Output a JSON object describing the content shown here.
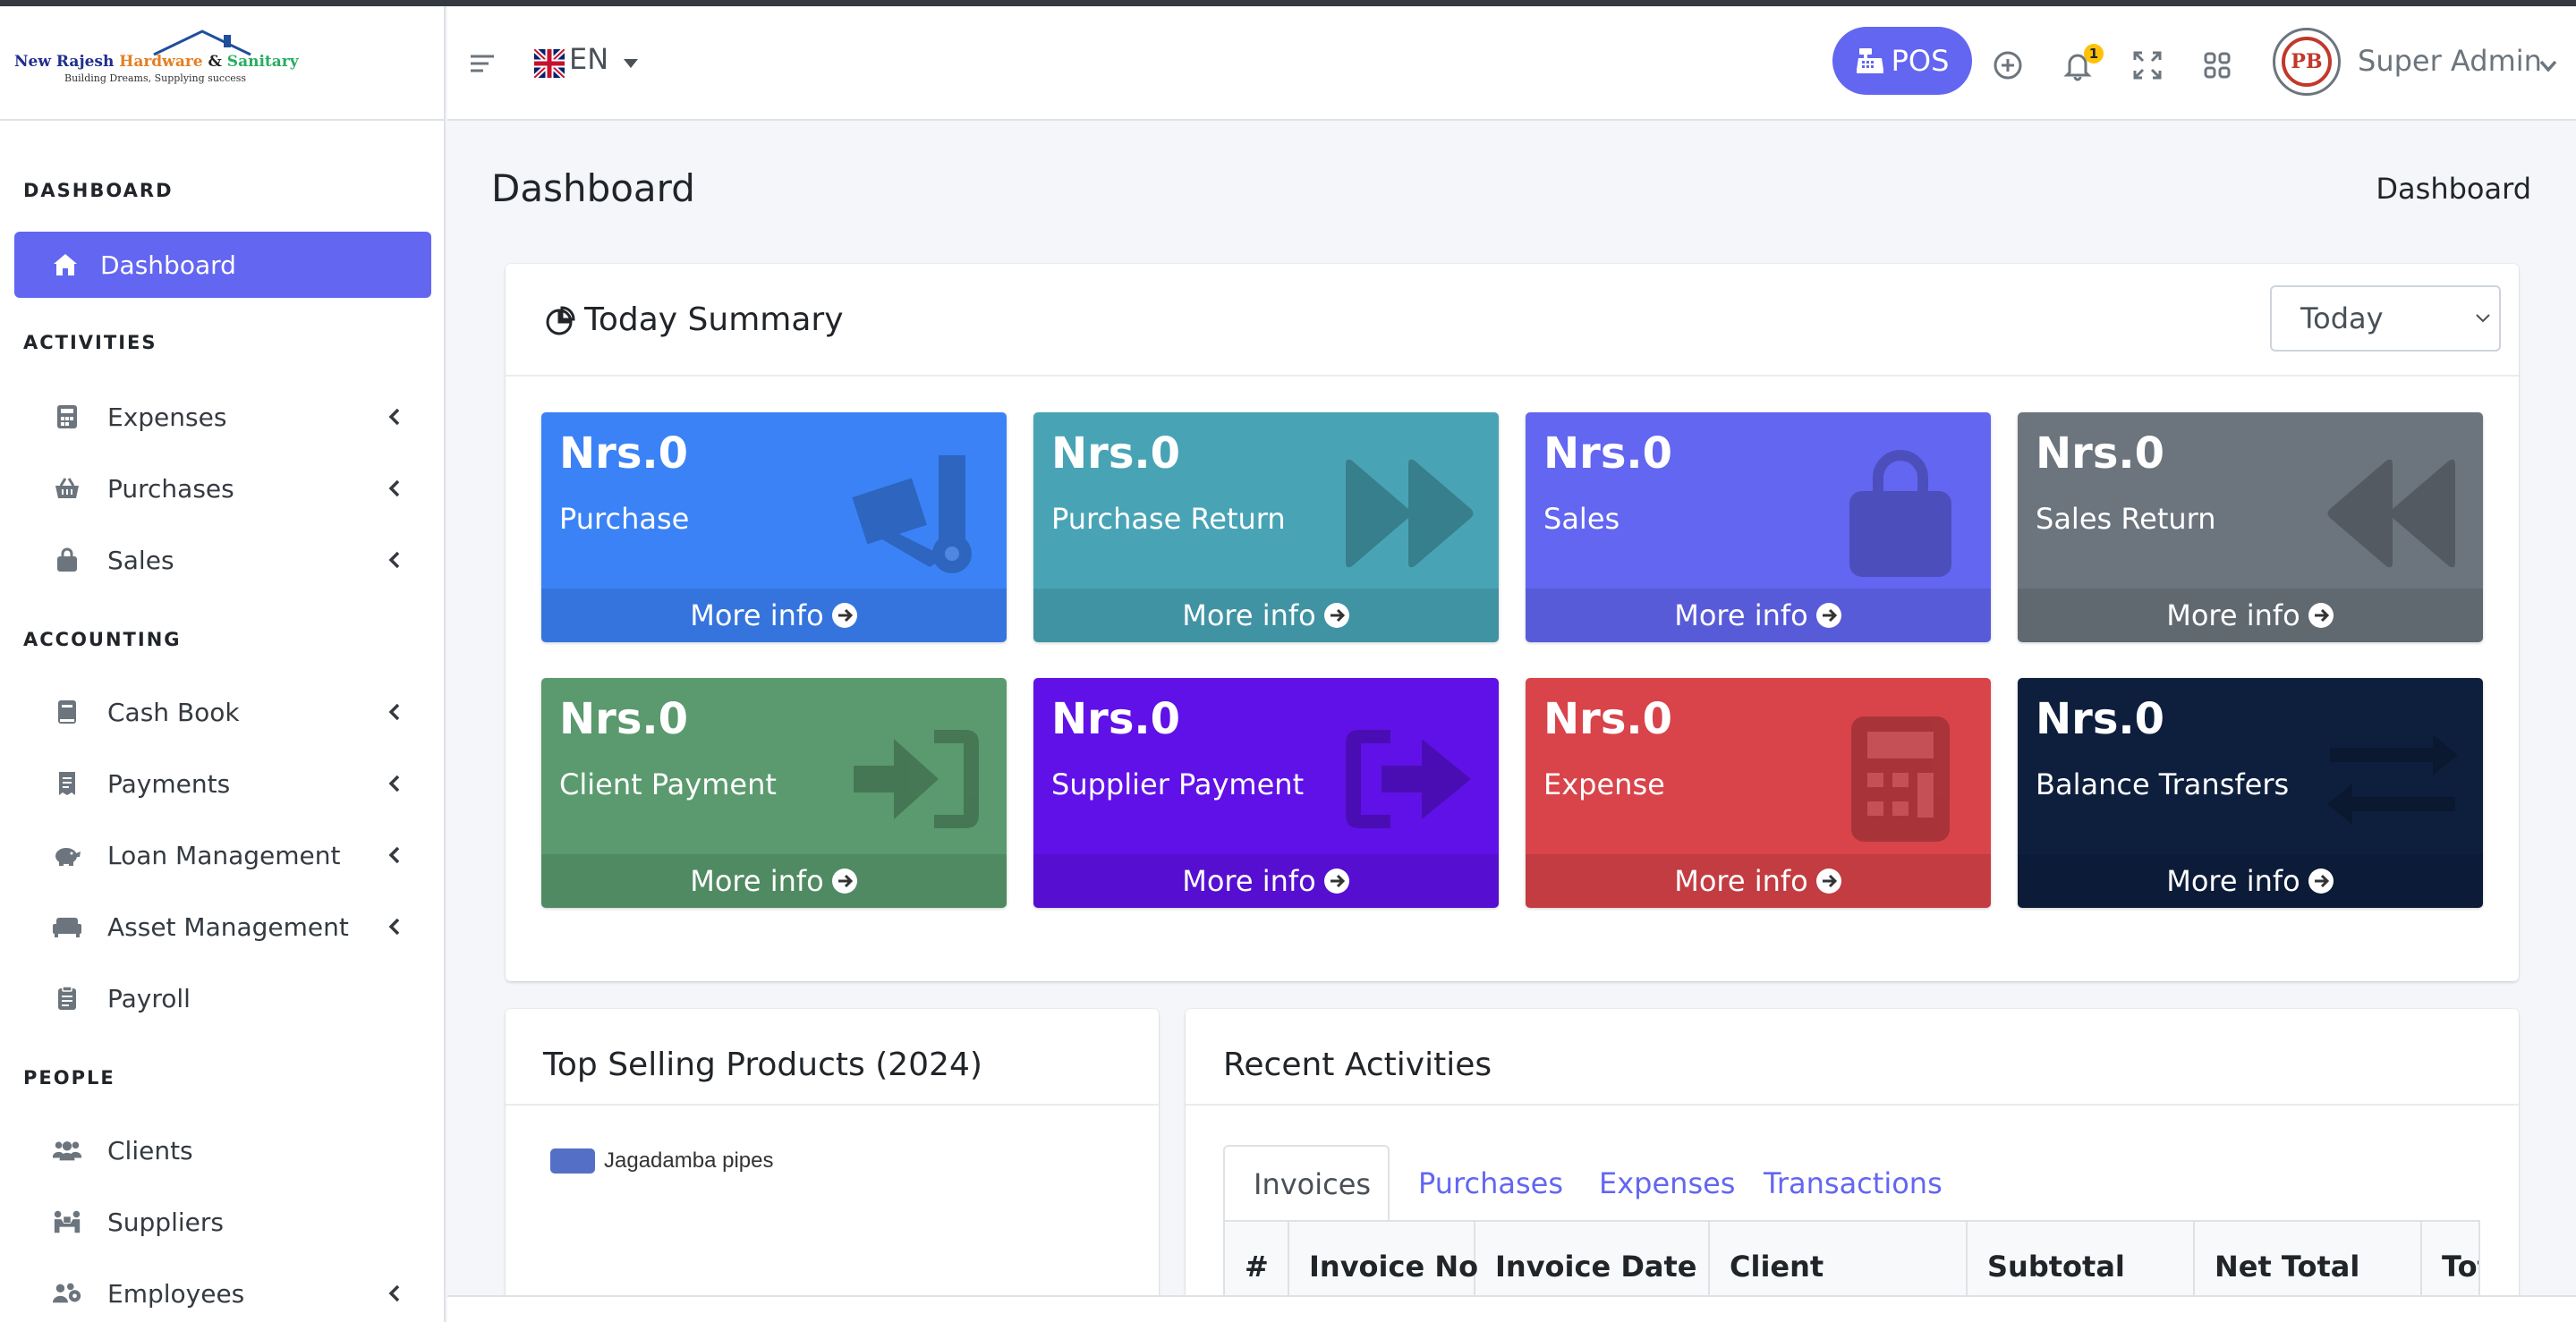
{
  "brand": {
    "line1_a": "New Rajesh ",
    "line1_b": "Hardware",
    "line1_c": " & ",
    "line1_d": "Sanitary",
    "tagline": "Building Dreams, Supplying success"
  },
  "sidebar": {
    "sections": [
      "DASHBOARD",
      "ACTIVITIES",
      "ACCOUNTING",
      "PEOPLE"
    ],
    "items": [
      {
        "label": "Dashboard"
      },
      {
        "label": "Expenses"
      },
      {
        "label": "Purchases"
      },
      {
        "label": "Sales"
      },
      {
        "label": "Cash Book"
      },
      {
        "label": "Payments"
      },
      {
        "label": "Loan Management"
      },
      {
        "label": "Asset Management"
      },
      {
        "label": "Payroll"
      },
      {
        "label": "Clients"
      },
      {
        "label": "Suppliers"
      },
      {
        "label": "Employees"
      }
    ]
  },
  "header": {
    "language": "EN",
    "pos_label": "POS",
    "notification_count": "1",
    "user_name": "Super Admin",
    "avatar_text": "PB"
  },
  "page": {
    "title": "Dashboard",
    "breadcrumb": "Dashboard"
  },
  "summary": {
    "title": "Today Summary",
    "period": "Today",
    "more_label": "More info",
    "boxes": [
      {
        "amount": "Nrs.0",
        "label": "Purchase",
        "color": "#3b82f6"
      },
      {
        "amount": "Nrs.0",
        "label": "Purchase Return",
        "color": "#48a4b5"
      },
      {
        "amount": "Nrs.0",
        "label": "Sales",
        "color": "#6366f1"
      },
      {
        "amount": "Nrs.0",
        "label": "Sales Return",
        "color": "#6c757d"
      },
      {
        "amount": "Nrs.0",
        "label": "Client Payment",
        "color": "#5a9a6e"
      },
      {
        "amount": "Nrs.0",
        "label": "Supplier Payment",
        "color": "#6011e8"
      },
      {
        "amount": "Nrs.0",
        "label": "Expense",
        "color": "#d9434a"
      },
      {
        "amount": "Nrs.0",
        "label": "Balance Transfers",
        "color": "#0e1f3e"
      }
    ]
  },
  "top_selling": {
    "title": "Top Selling Products (2024)",
    "legend": [
      "Jagadamba pipes"
    ],
    "legend_color": "#5470c6"
  },
  "recent": {
    "title": "Recent Activities",
    "tabs": [
      "Invoices",
      "Purchases",
      "Expenses",
      "Transactions"
    ],
    "columns": [
      "#",
      "Invoice No",
      "Invoice Date",
      "Client",
      "Subtotal",
      "Net Total",
      "Tot"
    ]
  }
}
